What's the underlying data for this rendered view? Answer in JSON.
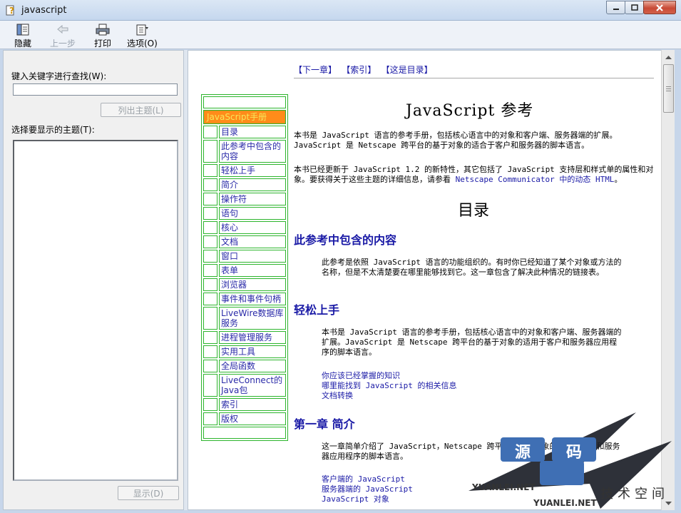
{
  "window": {
    "title": "javascript"
  },
  "toolbar": {
    "hide": "隐藏",
    "back": "上一步",
    "print": "打印",
    "options": "选项(O)"
  },
  "left": {
    "keyword_label": "键入关键字进行查找(W):",
    "keyword_value": "",
    "list_topics": "列出主题(L)",
    "select_label": "选择要显示的主题(T):",
    "display": "显示(D)"
  },
  "nav": {
    "next": "下一章",
    "index": "索引",
    "toc": "这是目录"
  },
  "toc": {
    "header": "JavaScript手册",
    "items": [
      "目录",
      "此参考中包含的内容",
      "轻松上手",
      "简介",
      "操作符",
      "语句",
      "核心",
      "文档",
      "窗口",
      "表单",
      "浏览器",
      "事件和事件句柄",
      "LiveWire数据库服务",
      "进程管理服务",
      "实用工具",
      "全局函数",
      "LiveConnect的Java包",
      "索引",
      "版权"
    ]
  },
  "content": {
    "title": "JavaScript 参考",
    "intro1": "本书是 JavaScript 语言的参考手册，包括核心语言中的对象和客户端、服务器端的扩展。JavaScript 是 Netscape 跨平台的基于对象的适合于客户和服务器的脚本语言。",
    "intro2a": "本书已经更新于 JavaScript 1.2 的新特性，其它包括了 JavaScript 支持层和样式单的属性和对象。要获得关于这些主题的详细信息，请参看 ",
    "intro2_link": "Netscape Communicator 中的动态 HTML",
    "intro2b": "。",
    "toc_heading": "目录",
    "sec1_title": "此参考中包含的内容",
    "sec1_body": "此参考是依照 JavaScript 语言的功能组织的。有时你已经知道了某个对象或方法的名称，但是不太清楚要在哪里能够找到它。这一章包含了解决此种情况的链接表。",
    "sec2_title": "轻松上手",
    "sec2_body": "本书是 JavaScript 语言的参考手册，包括核心语言中的对象和客户端、服务器端的扩展。JavaScript 是 Netscape 跨平台的基于对象的适用于客户和服务器应用程序的脚本语言。",
    "sec2_links": [
      "你应该已经掌握的知识",
      "哪里能找到 JavaScript 的相关信息",
      "文档转换"
    ],
    "sec3_title": "第一章 简介",
    "sec3_body": "这一章简单介绍了 JavaScript，Netscape 跨平台的基于对象的适用于客户和服务器应用程序的脚本语言。",
    "sec3_links": [
      "客户端的 JavaScript",
      "服务器端的 JavaScript",
      "JavaScript 对象"
    ]
  },
  "watermark": {
    "chars": [
      "源",
      "码"
    ],
    "brand": "YUANLEI.NET",
    "cn": "技术空间"
  },
  "colors": {
    "toc_border": "#2db52d",
    "toc_header_bg": "#ff8c1a",
    "link": "#1a1aa6"
  }
}
